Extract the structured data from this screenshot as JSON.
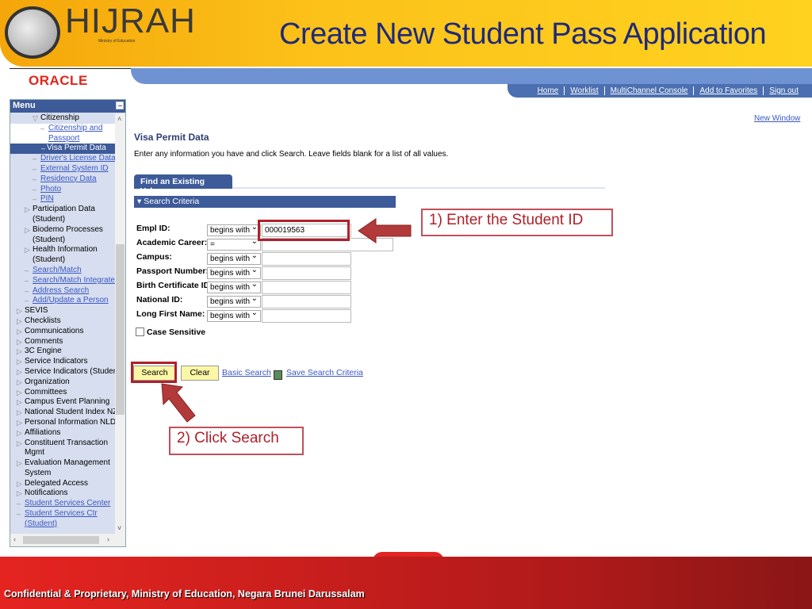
{
  "slide": {
    "title": "Create New Student Pass Application",
    "footer": "Confidential & Proprietary, Ministry of Education, Negara Brunei Darussalam",
    "logo_text": "HIJRAH",
    "logo_sub": "Ministry of Education",
    "oracle": "ORACLE"
  },
  "nav": {
    "links": [
      "Home",
      "Worklist",
      "MultiChannel Console",
      "Add to Favorites",
      "Sign out"
    ],
    "new_window": "New Window"
  },
  "menu": {
    "title": "Menu",
    "items": [
      {
        "t": "Citizenship",
        "kind": "open",
        "lvl": 3
      },
      {
        "t": "Citizenship and",
        "kind": "link",
        "lvl": 4,
        "white": true
      },
      {
        "t": "Passport",
        "kind": "cont",
        "lvl": 4,
        "white": true,
        "link": true
      },
      {
        "t": "Visa Permit Data",
        "kind": "sel",
        "lvl": 4
      },
      {
        "t": "Driver's License Data",
        "kind": "link",
        "lvl": 3
      },
      {
        "t": "External System ID",
        "kind": "link",
        "lvl": 3
      },
      {
        "t": "Residency Data",
        "kind": "link",
        "lvl": 3
      },
      {
        "t": "Photo",
        "kind": "link",
        "lvl": 3
      },
      {
        "t": "PIN",
        "kind": "link",
        "lvl": 3
      },
      {
        "t": "Participation Data",
        "kind": "closed",
        "lvl": 2
      },
      {
        "t": "(Student)",
        "kind": "cont",
        "lvl": 2
      },
      {
        "t": "Biodemo Processes",
        "kind": "closed",
        "lvl": 2
      },
      {
        "t": "(Student)",
        "kind": "cont",
        "lvl": 2
      },
      {
        "t": "Health Information",
        "kind": "closed",
        "lvl": 2
      },
      {
        "t": "(Student)",
        "kind": "cont",
        "lvl": 2
      },
      {
        "t": "Search/Match",
        "kind": "link",
        "lvl": 2
      },
      {
        "t": "Search/Match Integrated",
        "kind": "link",
        "lvl": 2
      },
      {
        "t": "Address Search",
        "kind": "link",
        "lvl": 2
      },
      {
        "t": "Add/Update a Person",
        "kind": "link",
        "lvl": 2
      },
      {
        "t": "SEVIS",
        "kind": "closed",
        "lvl": 1
      },
      {
        "t": "Checklists",
        "kind": "closed",
        "lvl": 1
      },
      {
        "t": "Communications",
        "kind": "closed",
        "lvl": 1
      },
      {
        "t": "Comments",
        "kind": "closed",
        "lvl": 1
      },
      {
        "t": "3C Engine",
        "kind": "closed",
        "lvl": 1
      },
      {
        "t": "Service Indicators",
        "kind": "closed",
        "lvl": 1
      },
      {
        "t": "Service Indicators (Student)",
        "kind": "closed",
        "lvl": 1
      },
      {
        "t": "Organization",
        "kind": "closed",
        "lvl": 1
      },
      {
        "t": "Committees",
        "kind": "closed",
        "lvl": 1
      },
      {
        "t": "Campus Event Planning",
        "kind": "closed",
        "lvl": 1
      },
      {
        "t": "National Student Index NZL",
        "kind": "closed",
        "lvl": 1
      },
      {
        "t": "Personal Information NLD",
        "kind": "closed",
        "lvl": 1
      },
      {
        "t": "Affiliations",
        "kind": "closed",
        "lvl": 1
      },
      {
        "t": "Constituent Transaction",
        "kind": "closed",
        "lvl": 1
      },
      {
        "t": "Mgmt",
        "kind": "cont",
        "lvl": 1
      },
      {
        "t": "Evaluation Management",
        "kind": "closed",
        "lvl": 1
      },
      {
        "t": "System",
        "kind": "cont",
        "lvl": 1
      },
      {
        "t": "Delegated Access",
        "kind": "closed",
        "lvl": 1
      },
      {
        "t": "Notifications",
        "kind": "closed",
        "lvl": 1
      },
      {
        "t": "Student Services Center",
        "kind": "link",
        "lvl": 1
      },
      {
        "t": "Student Services Ctr",
        "kind": "link",
        "lvl": 1
      },
      {
        "t": "(Student)",
        "kind": "cont",
        "lvl": 1,
        "link": true
      }
    ]
  },
  "page": {
    "title": "Visa Permit Data",
    "instructions": "Enter any information you have and click Search. Leave fields blank for a list of all values.",
    "tab": "Find an Existing Value",
    "section": "Search Criteria",
    "fields": [
      {
        "label": "Empl ID:",
        "op": "begins with",
        "value": "000019563"
      },
      {
        "label": "Academic Career:",
        "op": "=",
        "value": ""
      },
      {
        "label": "Campus:",
        "op": "begins with",
        "value": ""
      },
      {
        "label": "Passport Number:",
        "op": "begins with",
        "value": ""
      },
      {
        "label": "Birth Certificate ID:",
        "op": "begins with",
        "value": ""
      },
      {
        "label": "National ID:",
        "op": "begins with",
        "value": ""
      },
      {
        "label": "Long First Name:",
        "op": "begins with",
        "value": ""
      }
    ],
    "case_sensitive": "Case Sensitive",
    "case_checked": false,
    "search": "Search",
    "clear": "Clear",
    "basic_search": "Basic Search",
    "save_criteria": "Save Search Criteria"
  },
  "callouts": {
    "step1": "1) Enter the Student ID",
    "step2": "2) Click Search"
  }
}
